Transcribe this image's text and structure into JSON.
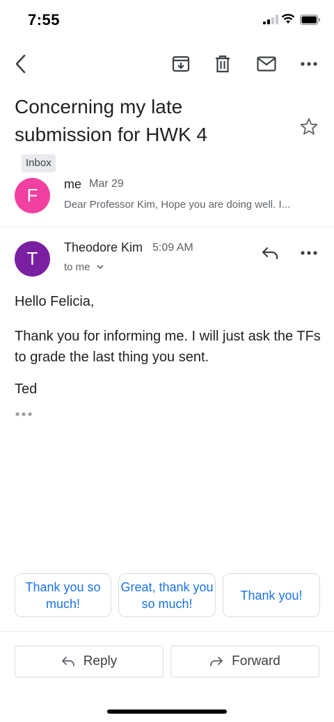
{
  "status_bar": {
    "time": "7:55"
  },
  "toolbar": {
    "back_icon": "arrow-left-icon",
    "archive_icon": "archive-icon",
    "delete_icon": "trash-icon",
    "mark_unread_icon": "mail-icon",
    "more_icon": "more-horizontal-icon"
  },
  "subject": {
    "text": "Concerning my late submission for HWK 4",
    "label": "Inbox"
  },
  "messages": [
    {
      "avatar_letter": "F",
      "avatar_color": "#f1409f",
      "sender": "me",
      "date": "Mar 29",
      "snippet": "Dear Professor Kim, Hope you are doing well. I..."
    },
    {
      "avatar_letter": "T",
      "avatar_color": "#7b1fa2",
      "sender": "Theodore Kim",
      "time": "5:09 AM",
      "recipients": "to me",
      "body": {
        "greeting": "Hello Felicia,",
        "paragraph": "Thank you for informing me. I will just ask the TFs to grade the last thing you sent.",
        "signoff": "Ted"
      }
    }
  ],
  "smart_replies": [
    "Thank you so much!",
    "Great, thank you so much!",
    "Thank you!"
  ],
  "actions": {
    "reply": "Reply",
    "forward": "Forward"
  },
  "colors": {
    "accent": "#1a73e8",
    "text": "#202124",
    "secondary": "#5f6368",
    "border": "#dadce0"
  }
}
